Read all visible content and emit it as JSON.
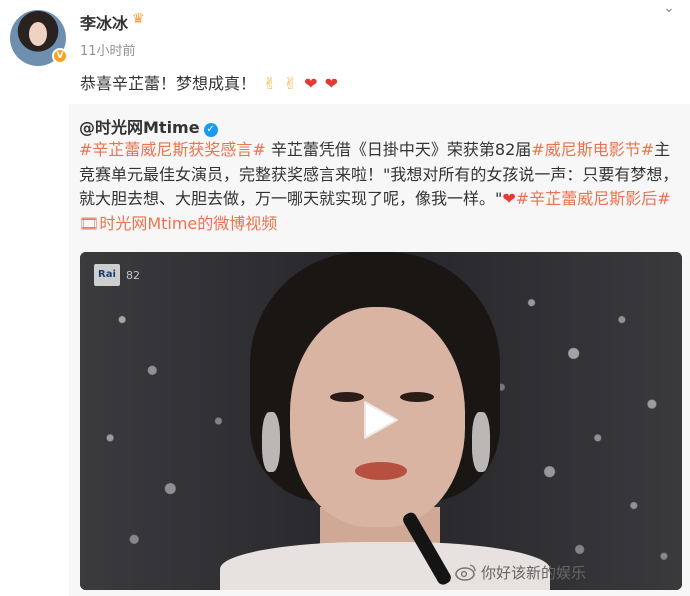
{
  "author": {
    "name": "李冰冰",
    "badge_icon": "crown-icon",
    "timestamp": "11小时前"
  },
  "post": {
    "text": "恭喜辛芷蕾！梦想成真！",
    "emojis": [
      "victory-hand",
      "victory-hand",
      "red-heart",
      "red-heart"
    ]
  },
  "repost": {
    "author": "@时光网Mtime",
    "verified_icon": "verified-icon",
    "segments": [
      {
        "text": "#辛芷蕾威尼斯获奖感言#",
        "type": "tag"
      },
      {
        "text": " 辛芷蕾凭借《日掛中天》荣获第82届",
        "type": "text"
      },
      {
        "text": "#威尼斯电影节#",
        "type": "tag"
      },
      {
        "text": "主竞赛单元最佳女演员，完整获奖感言来啦！\"我想对所有的女孩说一声：只要有梦想，就大胆去想、大胆去做，万一哪天就实现了呢，像我一样。\"",
        "type": "text"
      },
      {
        "text": "❤",
        "type": "heart"
      },
      {
        "text": "#辛芷蕾威尼斯影后#",
        "type": "tag"
      },
      {
        "text": " ",
        "type": "text"
      },
      {
        "text": "🎞时光网Mtime的微博视频",
        "type": "tag"
      }
    ],
    "video": {
      "broadcaster": "Rai",
      "festival": "82"
    }
  },
  "watermark": {
    "text": "你好该新的娱乐"
  },
  "colors": {
    "tag": "#eb7350",
    "verified": "#1a9bf0",
    "heart": "#e53935"
  }
}
